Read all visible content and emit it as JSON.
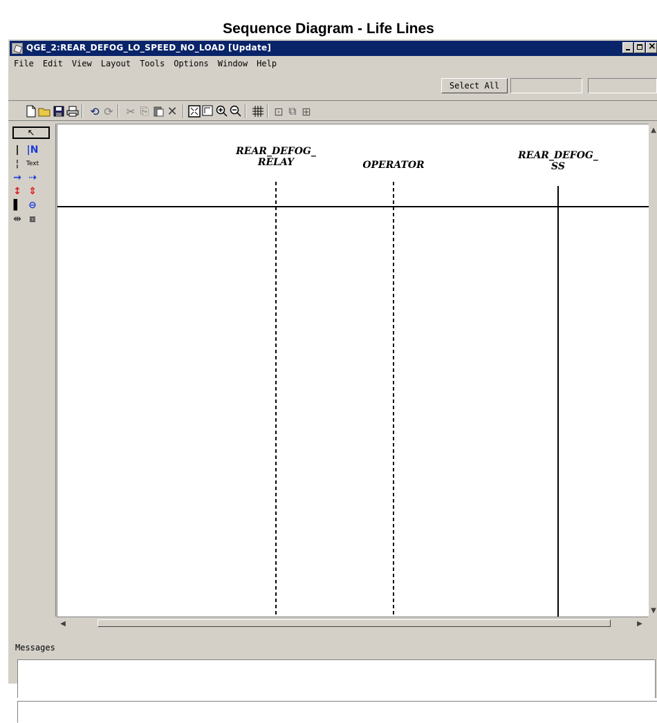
{
  "heading": "Sequence Diagram - Life Lines",
  "window": {
    "title": "QGE_2:REAR_DEFOG_LO_SPEED_NO_LOAD  [Update]"
  },
  "menu": [
    "File",
    "Edit",
    "View",
    "Layout",
    "Tools",
    "Options",
    "Window",
    "Help"
  ],
  "select_all_label": "Select All",
  "toolbar_icons": [
    "new-icon",
    "open-icon",
    "save-icon",
    "print-icon",
    "undo-icon",
    "redo-icon",
    "cut-icon",
    "copy-icon",
    "paste-icon",
    "delete-icon",
    "fit-icon",
    "zoom-region-icon",
    "zoom-in-icon",
    "zoom-out-icon",
    "grid-icon",
    "properties-icon",
    "copy-format-icon",
    "paste-format-icon"
  ],
  "palette_icons": [
    "select-arrow-icon",
    "lifeline-icon",
    "named-lifeline-icon",
    "dashed-lifeline-icon",
    "text-icon",
    "message-arrow-icon",
    "labeled-message-icon",
    "duration-icon",
    "timed-duration-icon",
    "activation-icon",
    "return-icon",
    "range-icon",
    "frame-icon"
  ],
  "lifelines": [
    {
      "name": "REAR_DEFOG_\nRELAY",
      "style": "dashed"
    },
    {
      "name": "OPERATOR",
      "style": "dashed"
    },
    {
      "name": "REAR_DEFOG_\nSS",
      "style": "solid"
    }
  ],
  "messages_label": "Messages"
}
